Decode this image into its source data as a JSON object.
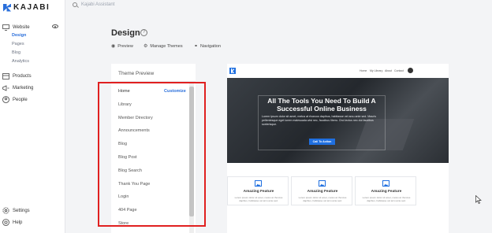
{
  "app": {
    "brand": "KAJABI"
  },
  "sidebar": {
    "website": "Website",
    "website_sub": [
      {
        "label": "Design",
        "active": true
      },
      {
        "label": "Pages"
      },
      {
        "label": "Blog"
      },
      {
        "label": "Analytics"
      }
    ],
    "products": "Products",
    "marketing": "Marketing",
    "people": "People",
    "settings": "Settings",
    "help": "Help"
  },
  "topbar": {
    "search_placeholder": "Kajabi Assistant"
  },
  "page": {
    "title": "Design",
    "actions": {
      "preview": "Preview",
      "manage_themes": "Manage Themes",
      "navigation": "Navigation"
    }
  },
  "theme_preview": {
    "title": "Theme Preview",
    "customize": "Customize",
    "pages": [
      "Home",
      "Library",
      "Member Directory",
      "Announcements",
      "Blog",
      "Blog Post",
      "Blog Search",
      "Thank You Page",
      "Login",
      "404 Page",
      "Store"
    ]
  },
  "site_preview": {
    "nav_links": [
      "Home",
      "My Library",
      "About",
      "Contact"
    ],
    "hero_title": "All The Tools You Need To Build A Successful Online Business",
    "hero_body": "Lorem ipsum dolor sit amet, metus at rhoncus dapibus, habitasse vel arcu ante sed. Mauris pellentesque eget lorem malesuada wisi nec, faucibus libero. Orci lectus nec dui faucibus scelerisque.",
    "hero_button": "Call To Action",
    "features": [
      {
        "title": "Amazing Feature",
        "text": "Lorem ipsum dolor sit amet, metus at rhoncus dapibus, habitasse vel arcu ante sed."
      },
      {
        "title": "Amazing Feature",
        "text": "Lorem ipsum dolor sit amet, metus at rhoncus dapibus, habitasse vel arcu ante sed."
      },
      {
        "title": "Amazing Feature",
        "text": "Lorem ipsum dolor sit amet, metus at rhoncus dapibus, habitasse vel arcu ante sed."
      }
    ]
  },
  "colors": {
    "accent": "#2a6fdb",
    "highlight": "#e02020"
  }
}
